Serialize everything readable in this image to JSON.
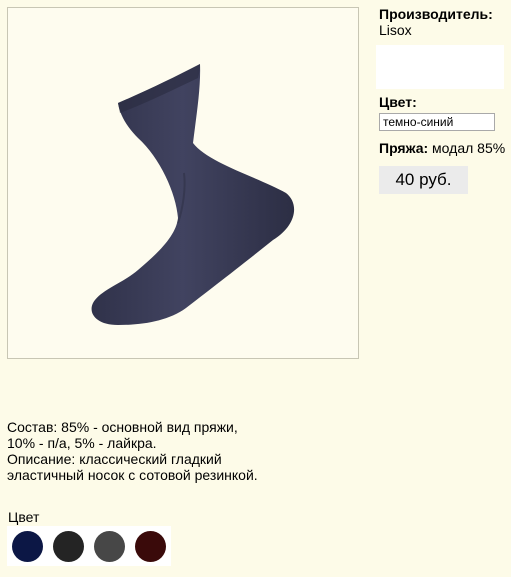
{
  "product": {
    "maker_label": "Производитель:",
    "maker_value": "Lisox",
    "color_label": "Цвет:",
    "color_selected": "темно-синий",
    "yarn_label": "Пряжа:",
    "yarn_value": "модал 85%",
    "price": "40 руб."
  },
  "description": {
    "line1": "Состав: 85% - основной вид пряжи, 10% - п/а, 5% - лайкра.",
    "line2": "Описание: классический гладкий эластичный носок с сотовой резинкой."
  },
  "colors": {
    "caption": "Цвет",
    "swatches": [
      {
        "name": "темно-синий",
        "hex": "#0c1745"
      },
      {
        "name": "черный",
        "hex": "#242424"
      },
      {
        "name": "серый",
        "hex": "#474747"
      },
      {
        "name": "коричневый",
        "hex": "#3a0a0a"
      }
    ]
  },
  "image": {
    "sock_color": "#3d3f57"
  }
}
